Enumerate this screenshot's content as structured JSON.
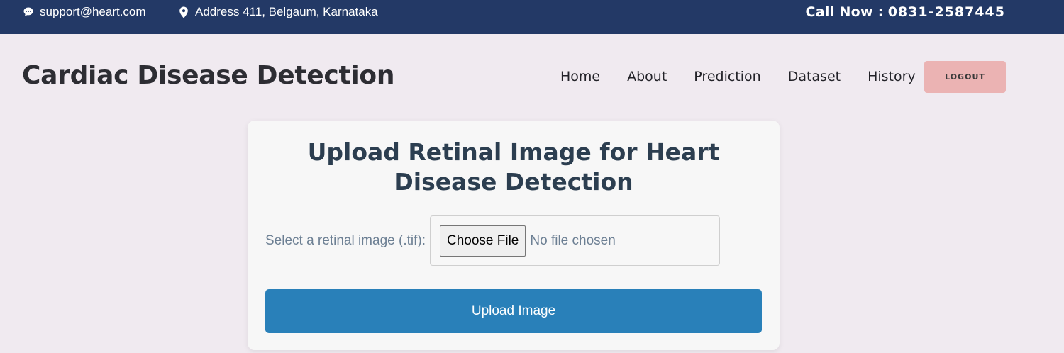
{
  "topbar": {
    "email": "support@heart.com",
    "email_icon": "chat-bubble-icon",
    "address": "Address 411, Belgaum, Karnataka",
    "address_icon": "map-pin-icon",
    "call_label": "Call Now :",
    "call_number": "0831-2587445",
    "background_color": "#233966"
  },
  "header": {
    "brand": "Cardiac Disease Detection",
    "nav": [
      {
        "label": "Home"
      },
      {
        "label": "About"
      },
      {
        "label": "Prediction"
      },
      {
        "label": "Dataset"
      },
      {
        "label": "History"
      }
    ],
    "logout_label": "LOGOUT",
    "logout_color": "#ebb3b3"
  },
  "upload_card": {
    "title": "Upload Retinal Image for Heart Disease Detection",
    "file_label": "Select a retinal image (.tif):",
    "choose_button": "Choose File",
    "file_status": "No file chosen",
    "submit_label": "Upload Image",
    "submit_color": "#2980b9"
  }
}
